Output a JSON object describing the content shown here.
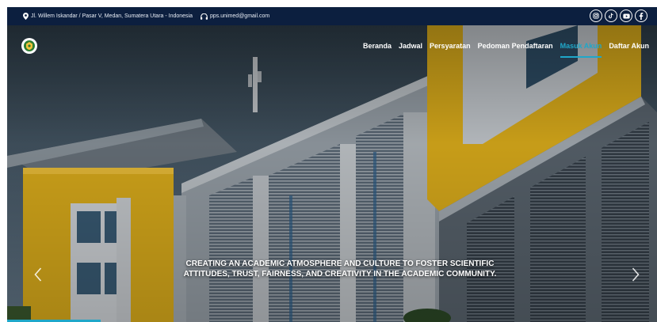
{
  "topbar": {
    "address": "Jl. Willem Iskandar / Pasar V, Medan, Sumatera Utara - Indonesia",
    "email": "pps.unimed@gmail.com",
    "socials": [
      "instagram-icon",
      "tiktok-icon",
      "youtube-icon",
      "facebook-icon"
    ]
  },
  "nav": {
    "items": [
      {
        "label": "Beranda"
      },
      {
        "label": "Jadwal"
      },
      {
        "label": "Persyaratan"
      },
      {
        "label": "Pedoman Pendaftaran"
      },
      {
        "label": "Masuk Akun",
        "active": true
      },
      {
        "label": "Daftar Akun"
      }
    ]
  },
  "hero": {
    "caption_line1": "CREATING AN ACADEMIC ATMOSPHERE AND CULTURE TO FOSTER SCIENTIFIC",
    "caption_line2": "ATTITUDES, TRUST, FAIRNESS, AND CREATIVITY IN THE ACADEMIC COMMUNITY."
  },
  "colors": {
    "topbar": "#0c1f3f",
    "accent": "#1fa7c9",
    "building_yellow": "#e2b21c"
  }
}
